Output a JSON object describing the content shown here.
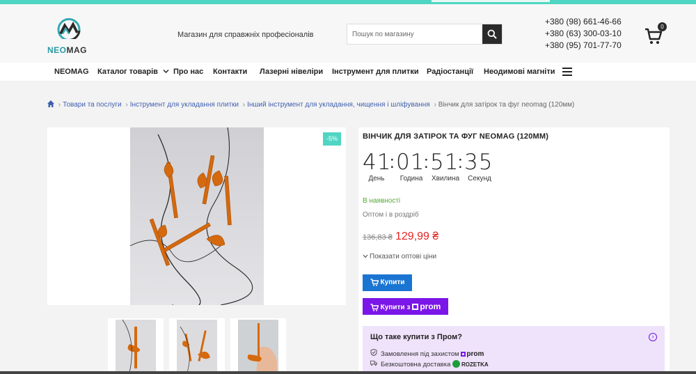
{
  "brand": {
    "logo_text_a": "NEO",
    "logo_text_b": "MAG"
  },
  "header": {
    "tagline": "Магазин для справжніх професіоналів",
    "search_placeholder": "Пошук по магазину",
    "phones": [
      "+380 (98) 661-46-66",
      "+380 (63) 300-03-10",
      "+380 (95) 701-77-70"
    ],
    "cart_count": "0"
  },
  "nav": {
    "items": [
      "NEOMAG",
      "Каталог товарів",
      "Про нас",
      "Контакти",
      "Лазерні нівеліри",
      "Інструмент для плитки",
      "Радіостанції",
      "Неодимові магніти"
    ]
  },
  "breadcrumb": {
    "items": [
      "Товари та послуги",
      "Інструмент для укладання плитки",
      "Інший інструмент для укладання, чищення і шліфування"
    ],
    "current": "Вінчик для затірок та фуг neomag (120мм)"
  },
  "gallery": {
    "discount_badge": "-5%",
    "thumb_count": 3
  },
  "product": {
    "title": "ВІНЧИК ДЛЯ ЗАТІРОК ТА ФУГ NEOMAG (120ММ)",
    "countdown": {
      "days": "41",
      "hours": "01",
      "minutes": "51",
      "seconds": "35",
      "labels": [
        "День",
        "Година",
        "Хвилина",
        "Секунд"
      ]
    },
    "stock_status": "В наявності",
    "sale_type": "Оптом і в роздріб",
    "old_price": "136,83 ₴",
    "price": "129,99 ₴",
    "show_wholesale": "Показати оптові ціни",
    "buy_label": "Купити",
    "buy_prom_label": "Купити з",
    "prom_brand": "prom"
  },
  "prom_info": {
    "heading": "Що таке купити з Пром?",
    "row1": "Замовлення під захистом",
    "row1_brand": "prom",
    "row2": "Безкоштовна доставка",
    "row2_brand": "ROZETKA"
  },
  "colors": {
    "accent": "#4fd6c2",
    "buy": "#1a75d2",
    "prom": "#7b16e8",
    "price": "#e42323",
    "stock": "#55a630"
  }
}
